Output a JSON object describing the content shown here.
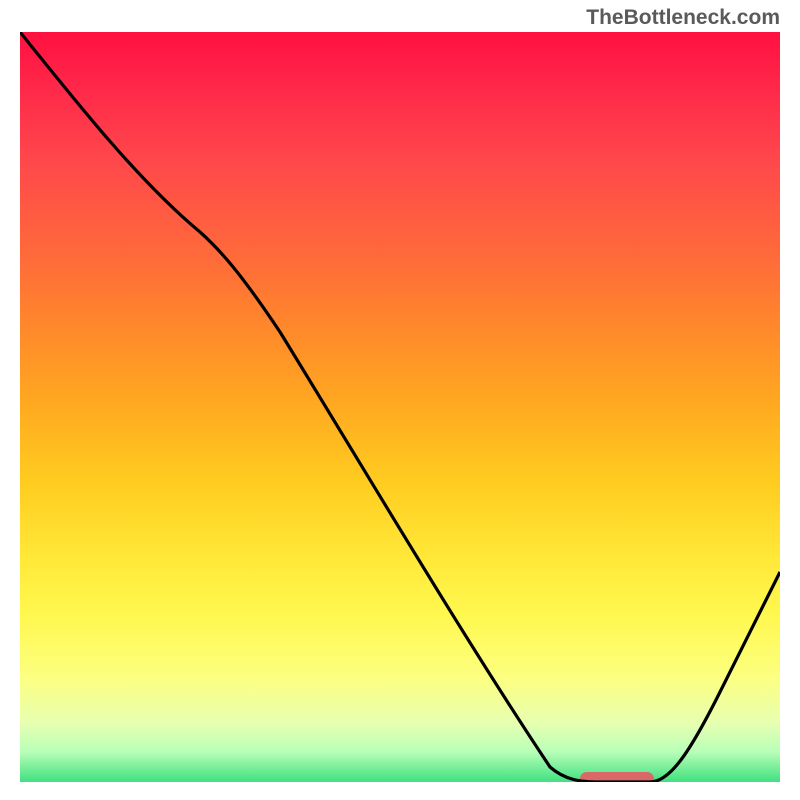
{
  "watermark": "TheBottleneck.com",
  "chart_data": {
    "type": "line",
    "title": "",
    "xlabel": "",
    "ylabel": "",
    "xlim": [
      0,
      100
    ],
    "ylim": [
      0,
      100
    ],
    "x": [
      0,
      12,
      24,
      70,
      76,
      82,
      100
    ],
    "values": [
      100,
      86,
      76,
      2,
      0,
      0,
      30
    ],
    "marker": {
      "x_start": 74,
      "x_end": 83,
      "y": 0,
      "color": "#d86a6a"
    },
    "background": "red-yellow-green vertical gradient"
  }
}
